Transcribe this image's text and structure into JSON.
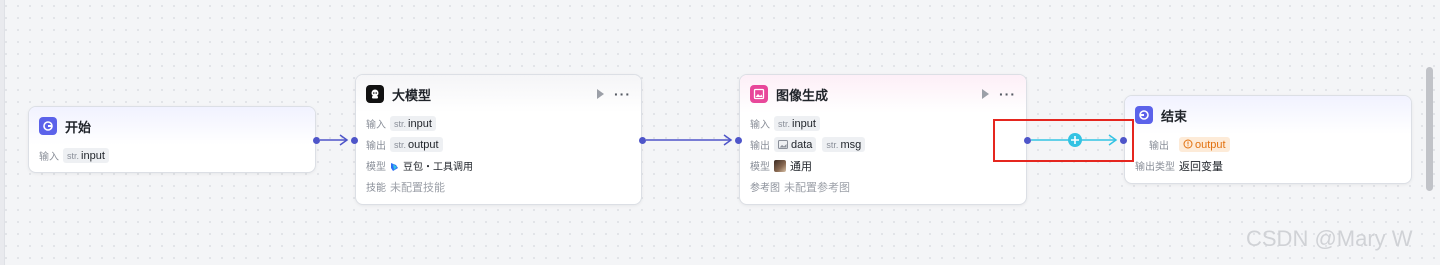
{
  "nodes": {
    "start": {
      "title": "开始",
      "input_label": "输入",
      "input_type": "str.",
      "input_name": "input"
    },
    "llm": {
      "title": "大模型",
      "input_label": "输入",
      "input_type": "str.",
      "input_name": "input",
      "output_label": "输出",
      "output_type": "str.",
      "output_name": "output",
      "model_label": "模型",
      "model_value": "豆包・工具调用",
      "skill_label": "技能",
      "skill_value": "未配置技能"
    },
    "image": {
      "title": "图像生成",
      "input_label": "输入",
      "input_type": "str.",
      "input_name": "input",
      "output_label": "输出",
      "output_data_name": "data",
      "output_msg_type": "str.",
      "output_msg_name": "msg",
      "model_label": "模型",
      "model_value": "通用",
      "ref_label": "参考图",
      "ref_value": "未配置参考图"
    },
    "end": {
      "title": "结束",
      "output_label": "输出",
      "output_name": "output",
      "output_type_label": "输出类型",
      "output_type_value": "返回变量"
    }
  },
  "icons": {
    "start": "start-icon",
    "llm": "llm-icon",
    "image": "image-gen-icon",
    "end": "end-icon",
    "run": "play-icon",
    "more": "more-icon",
    "add": "plus-icon"
  },
  "colors": {
    "accent": "#4e55c9",
    "start_icon": "#5b62ea",
    "end_icon": "#5b62ea",
    "image_icon": "#e8479a",
    "highlight": "#e5261f",
    "add_wire": "#33c3e3"
  },
  "watermark": "CSDN @Mary W"
}
